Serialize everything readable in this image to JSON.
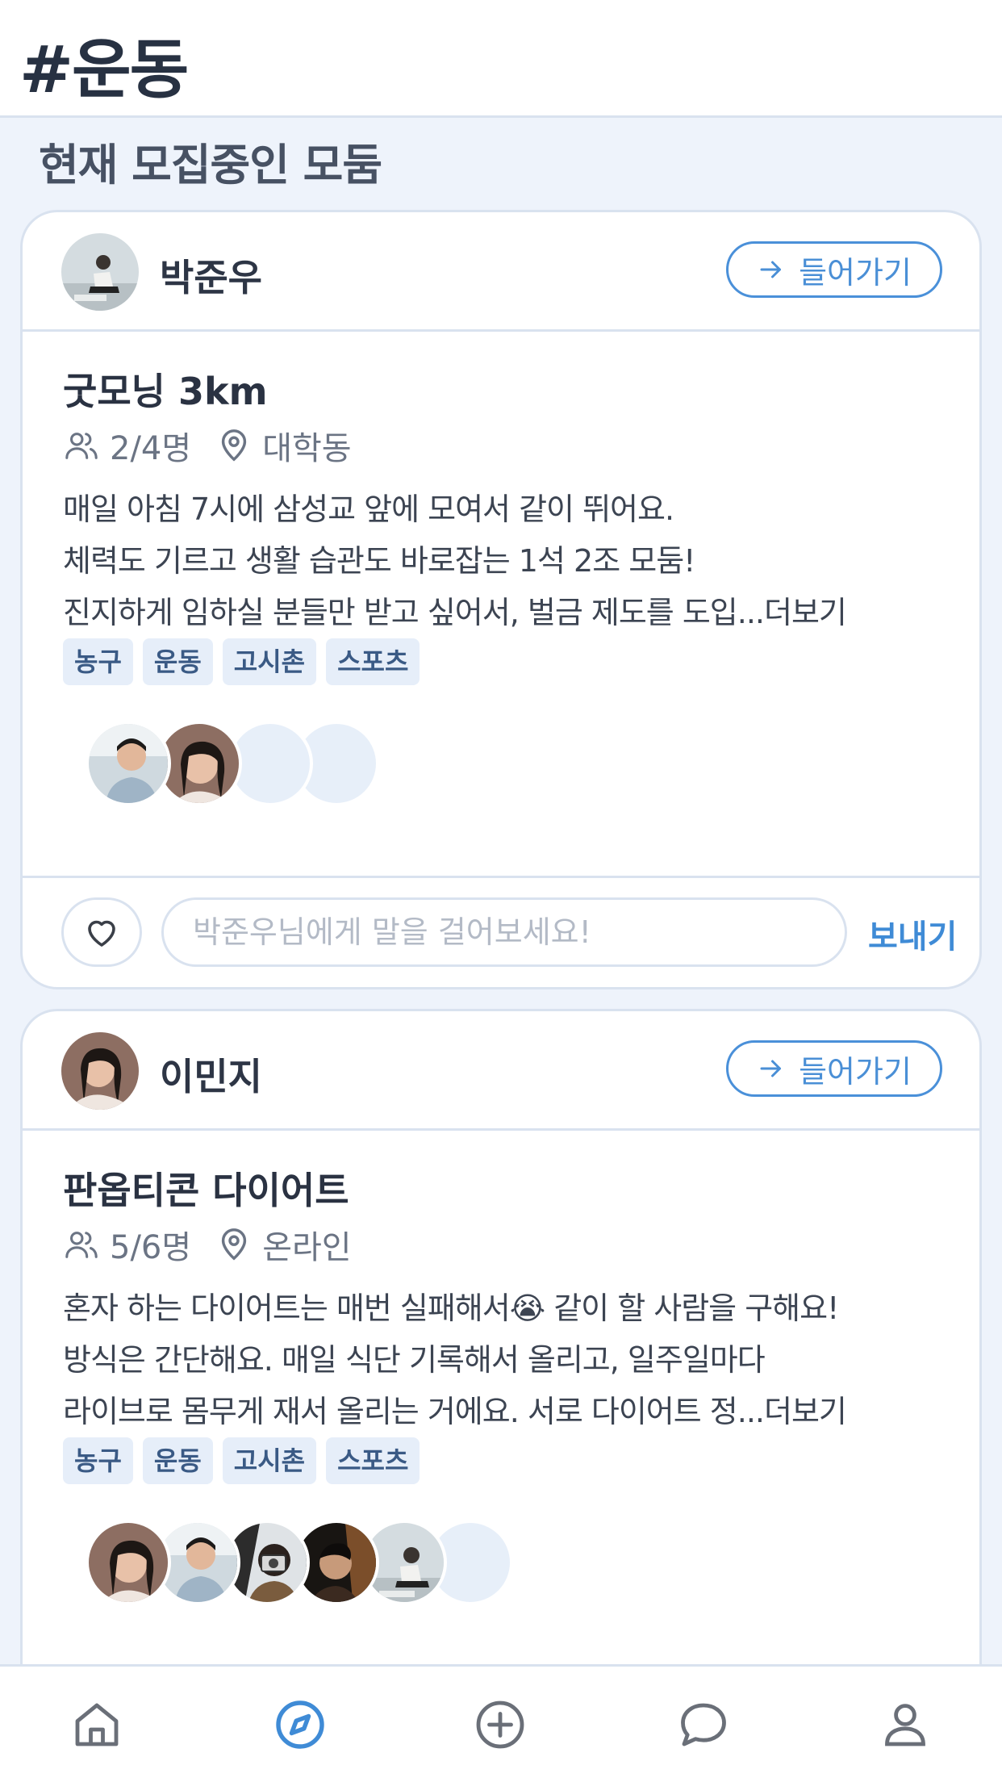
{
  "header": {
    "title": "#운동"
  },
  "section": {
    "title": "현재 모집중인 모둠"
  },
  "meetups": [
    {
      "host": {
        "name": "박준우"
      },
      "enter_label": "들어가기",
      "title": "굿모닝 3km",
      "members_count": "2/4명",
      "location": "대학동",
      "description": [
        "매일 아침 7시에 삼성교 앞에 모여서 같이 뛰어요.",
        "체력도 기르고 생활 습관도 바로잡는 1석 2조 모둠!",
        "진지하게 임하실 분들만 받고 싶어서, 벌금 제도를 도입...더보기"
      ],
      "tags": [
        "농구",
        "운동",
        "고시촌",
        "스포츠"
      ],
      "input_placeholder": "박준우님에게 말을 걸어보세요!",
      "send_label": "보내기"
    },
    {
      "host": {
        "name": "이민지"
      },
      "enter_label": "들어가기",
      "title": "판옵티콘 다이어트",
      "members_count": "5/6명",
      "location": "온라인",
      "description": [
        "혼자 하는 다이어트는 매번 실패해서😭 같이 할 사람을 구해요!",
        "방식은 간단해요. 매일 식단 기록해서 올리고, 일주일마다",
        "라이브로 몸무게 재서 올리는 거에요. 서로 다이어트 정...더보기"
      ],
      "tags": [
        "농구",
        "운동",
        "고시촌",
        "스포츠"
      ]
    }
  ],
  "tabbar": {
    "items": [
      {
        "icon": "home-icon",
        "active": false
      },
      {
        "icon": "compass-icon",
        "active": true
      },
      {
        "icon": "plus-circle-icon",
        "active": false
      },
      {
        "icon": "chat-icon",
        "active": false
      },
      {
        "icon": "profile-icon",
        "active": false
      }
    ]
  },
  "colors": {
    "accent": "#4a90d9",
    "border": "#d9e2ef",
    "background": "#eef3fb",
    "tag_bg": "#e6eef9",
    "tag_text": "#3a5a85"
  }
}
